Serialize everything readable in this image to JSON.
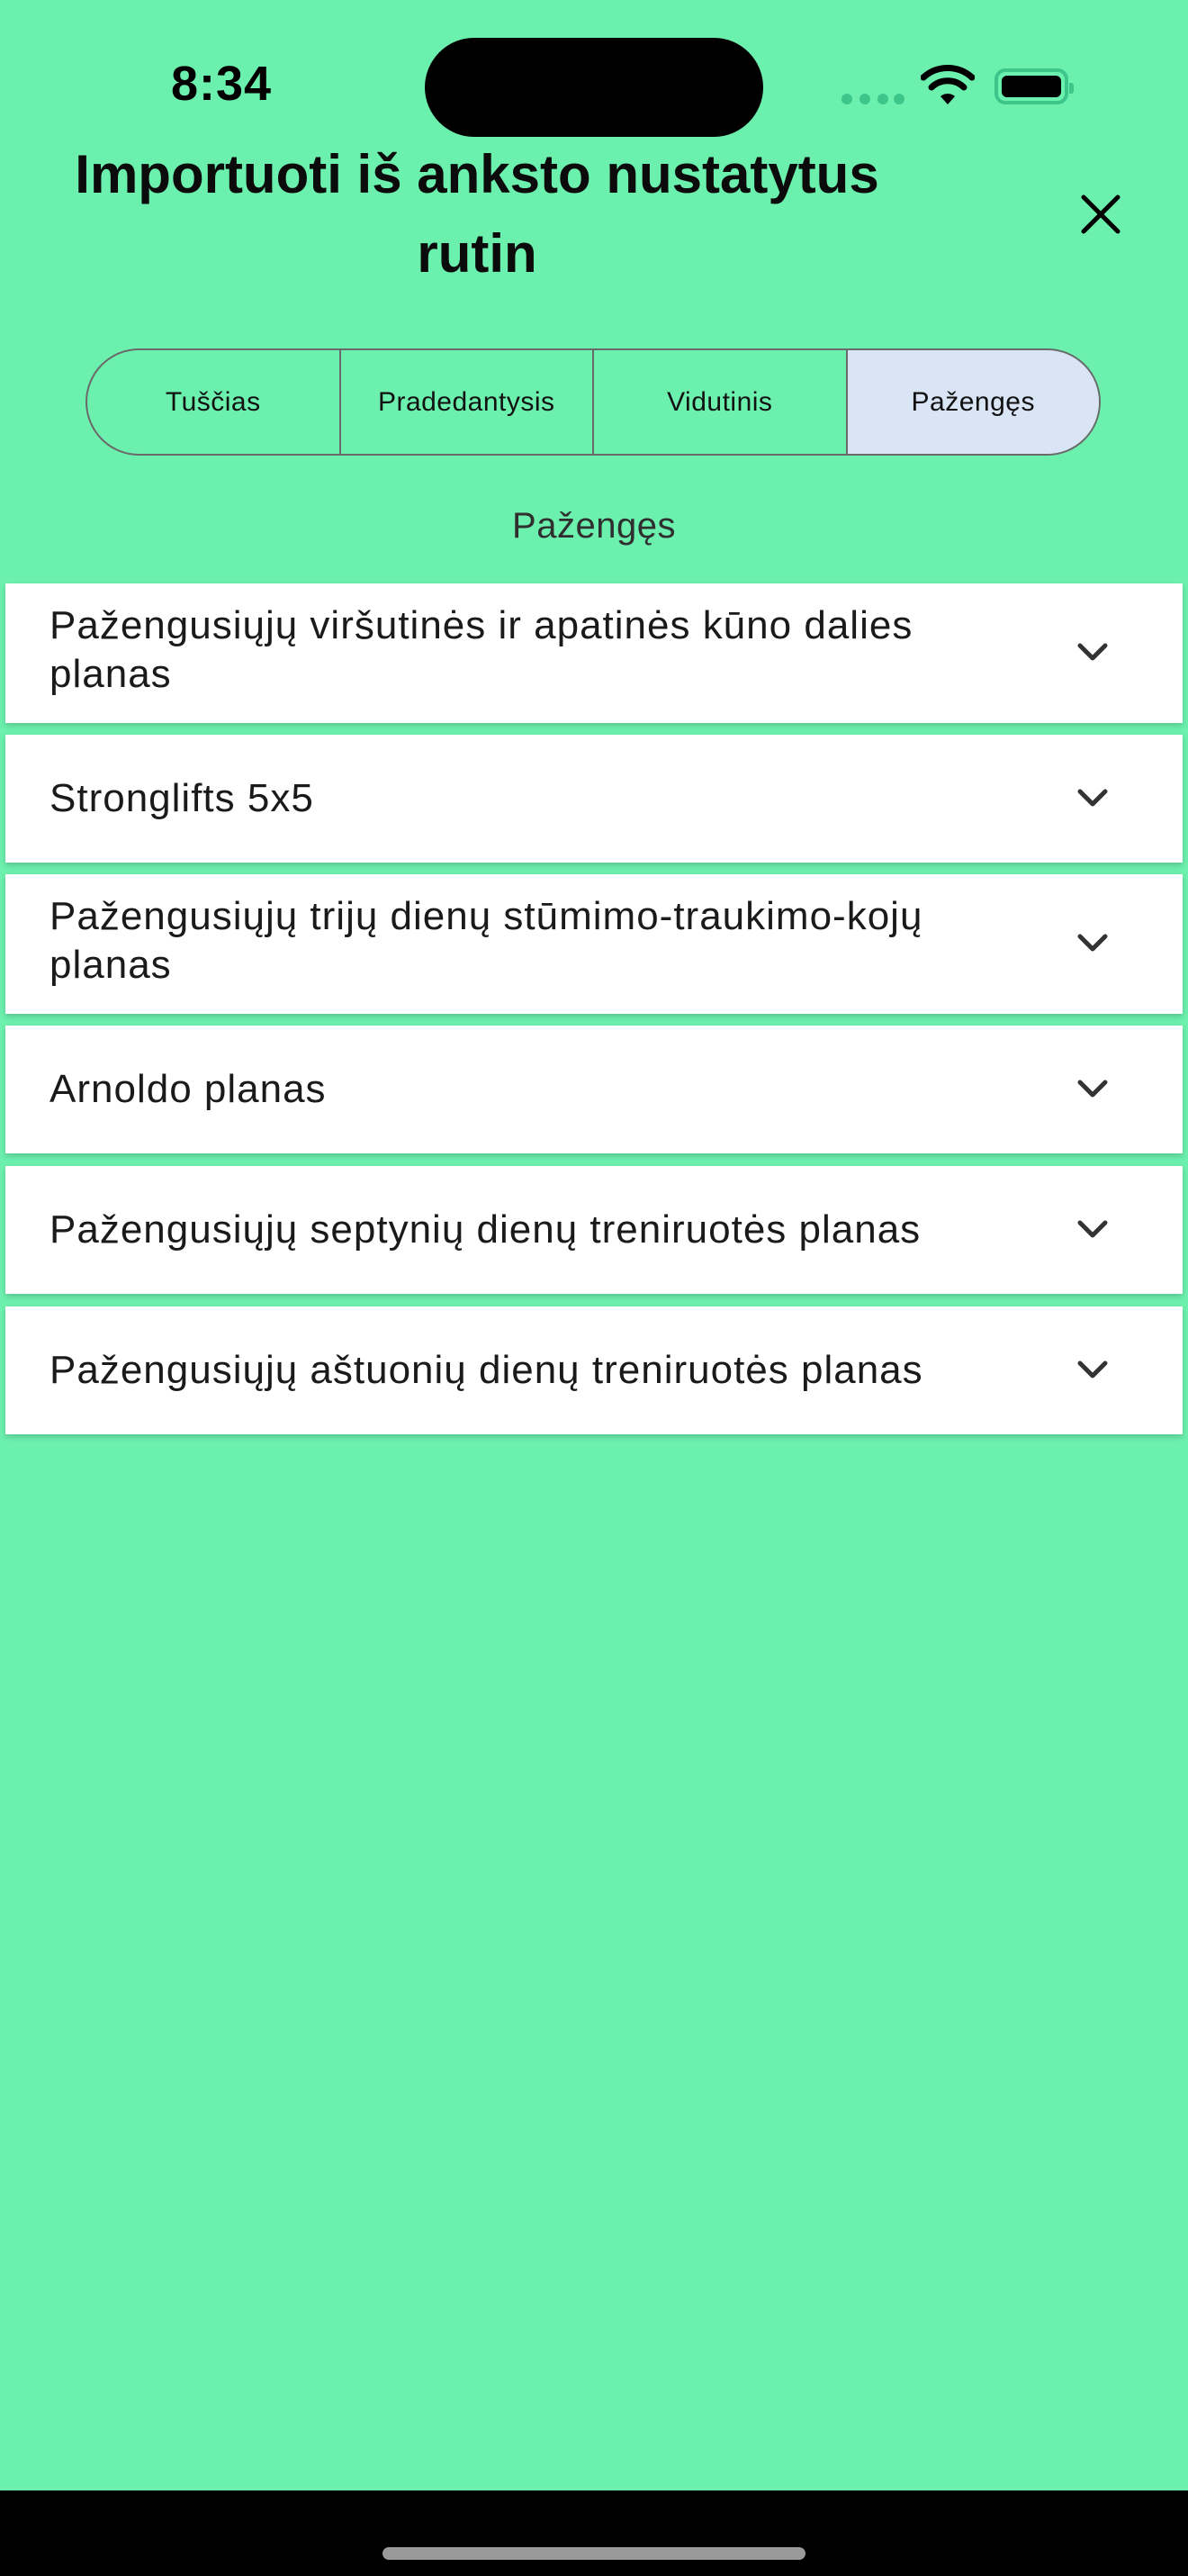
{
  "status_bar": {
    "time": "8:34",
    "wifi_icon": "wifi-icon",
    "battery_icon": "battery-icon"
  },
  "header": {
    "title": "Importuoti iš anksto nustatytus rutin",
    "close_icon": "close-icon"
  },
  "segments": [
    {
      "label": "Tuščias",
      "selected": false
    },
    {
      "label": "Pradedantysis",
      "selected": false
    },
    {
      "label": "Vidutinis",
      "selected": false
    },
    {
      "label": "Pažengęs",
      "selected": true
    }
  ],
  "section_label": "Pažengęs",
  "routines": [
    {
      "label": "Pažengusiųjų viršutinės ir apatinės kūno dalies planas",
      "icon": "chevron-down-icon"
    },
    {
      "label": "Stronglifts 5x5",
      "icon": "chevron-down-icon"
    },
    {
      "label": "Pažengusiųjų trijų dienų stūmimo-traukimo-kojų planas",
      "icon": "chevron-down-icon"
    },
    {
      "label": "Arnoldo planas",
      "icon": "chevron-down-icon"
    },
    {
      "label": "Pažengusiųjų septynių dienų treniruotės planas",
      "icon": "chevron-down-icon"
    },
    {
      "label": "Pažengusiųjų aštuonių dienų treniruotės planas",
      "icon": "chevron-down-icon"
    }
  ],
  "colors": {
    "background": "#6cf0ae",
    "selected_segment": "#d9e4f5",
    "card": "#ffffff"
  }
}
